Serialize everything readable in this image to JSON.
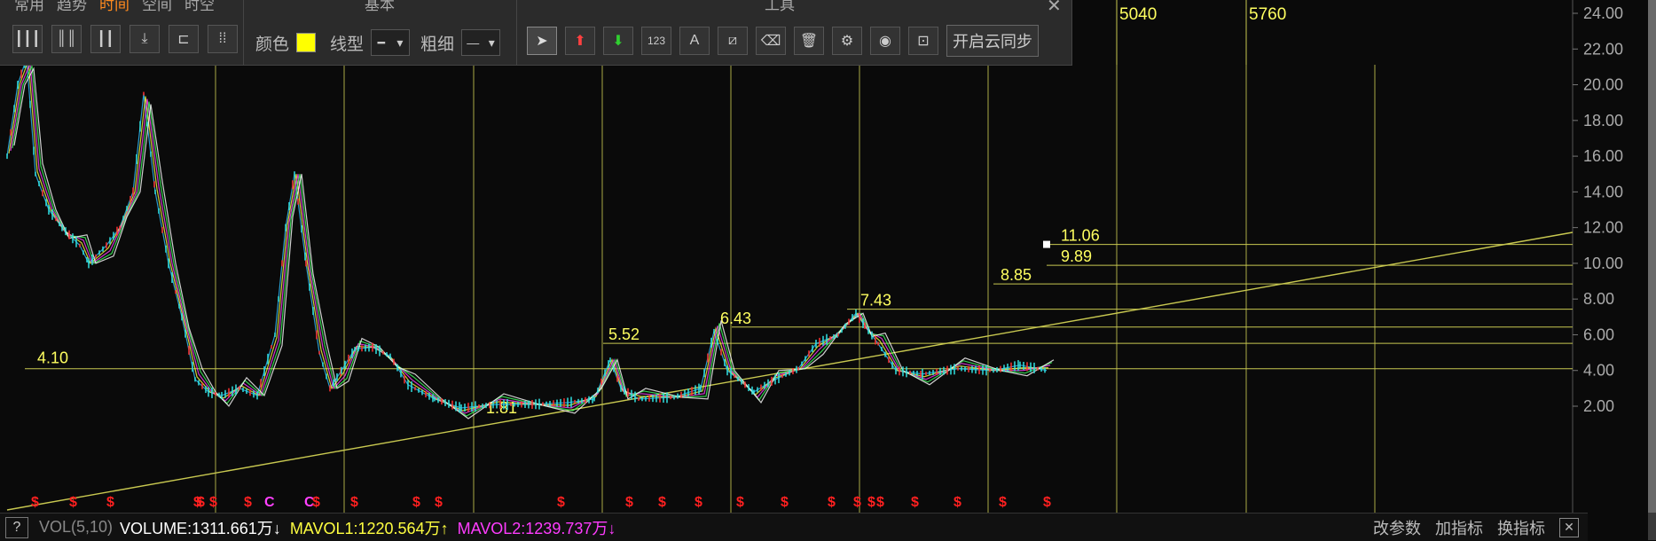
{
  "toolbar": {
    "tabs": [
      "常用",
      "趋势",
      "时间",
      "空间",
      "时空"
    ],
    "active_tab": "时间",
    "basic_header": "基本",
    "tools_header": "工具",
    "color_label": "颜色",
    "color_value": "#ffff00",
    "line_type_label": "线型",
    "thickness_label": "粗细",
    "sync_label": "开启云同步",
    "close_icon": "close-icon",
    "time_tools": [
      "cycle-lines-icon",
      "equal-cycle-icon",
      "fib-cycle-icon",
      "arrow-down-cycle-icon",
      "time-ruler-icon",
      "grid-cycle-icon"
    ],
    "basic_tools": [
      "cursor-icon",
      "arrow-up-icon",
      "arrow-down-icon",
      "text-123-icon",
      "text-a-icon",
      "ruler-icon",
      "eraser-icon",
      "trash-icon",
      "settings-icon",
      "eye-icon",
      "save-icon"
    ]
  },
  "chart_data": {
    "type": "line",
    "y_axis_labels": [
      "24.00",
      "22.00",
      "20.00",
      "18.00",
      "16.00",
      "14.00",
      "12.00",
      "10.00",
      "8.00",
      "6.00",
      "4.00",
      "2.00"
    ],
    "ylim": [
      0,
      25
    ],
    "time_markers": [
      "5040",
      "5760"
    ],
    "price_annotations": [
      "11.06",
      "9.89",
      "8.85",
      "7.43",
      "6.43",
      "5.52",
      "4.10",
      "1.81"
    ],
    "horizontal_levels": [
      11.06,
      9.89,
      8.85,
      7.43,
      6.43,
      5.52,
      4.1
    ],
    "signal_markers": [
      "$",
      "$",
      "$",
      "$",
      "$",
      "$",
      "$",
      "C",
      "C",
      "$",
      "$",
      "$",
      "$",
      "$",
      "$",
      "$",
      "$",
      "$",
      "$",
      "$",
      "$",
      "$",
      "$",
      "$",
      "$",
      "$",
      "$"
    ],
    "colors": {
      "grid": "#c8c850",
      "axis_text": "#aaaaaa",
      "annotation": "#ffff60",
      "signal": "#ff2020",
      "signal_c": "#ff40ff"
    }
  },
  "status": {
    "help": "?",
    "vol_label": "VOL(5,10)",
    "volume": "VOLUME:1311.661万",
    "volume_arrow": "↓",
    "mavol1": "MAVOL1:1220.564万",
    "mavol1_arrow": "↑",
    "mavol2": "MAVOL2:1239.737万",
    "mavol2_arrow": "↓",
    "right_buttons": [
      "改参数",
      "加指标",
      "换指标"
    ],
    "close": "✕"
  }
}
